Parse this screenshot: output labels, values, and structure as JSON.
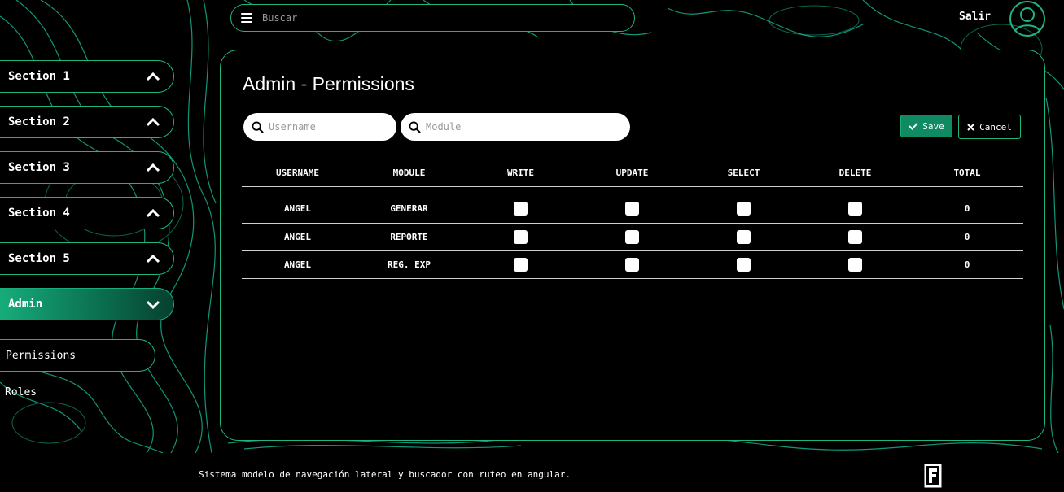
{
  "header": {
    "search_placeholder": "Buscar",
    "logout_label": "Salir"
  },
  "sidebar": {
    "sections": [
      {
        "label": "Section 1",
        "expanded": false
      },
      {
        "label": "Section 2",
        "expanded": false
      },
      {
        "label": "Section 3",
        "expanded": false
      },
      {
        "label": "Section 4",
        "expanded": false
      },
      {
        "label": "Section 5",
        "expanded": false
      },
      {
        "label": "Admin",
        "expanded": true
      }
    ],
    "sub_items": [
      {
        "label": "Permissions",
        "selected": true
      },
      {
        "label": "Roles",
        "selected": false
      }
    ]
  },
  "main": {
    "title_part1": "Admin",
    "title_sep": "-",
    "title_part2": "Permissions",
    "filters": {
      "username_placeholder": "Username",
      "module_placeholder": "Module"
    },
    "save_label": "Save",
    "cancel_label": "Cancel",
    "table": {
      "columns": [
        "USERNAME",
        "MODULE",
        "WRITE",
        "UPDATE",
        "SELECT",
        "DELETE",
        "TOTAL"
      ],
      "rows": [
        {
          "username": "ANGEL",
          "module": "GENERAR",
          "write": false,
          "update": false,
          "select": false,
          "delete": false,
          "total": "0"
        },
        {
          "username": "ANGEL",
          "module": "REPORTE",
          "write": false,
          "update": false,
          "select": false,
          "delete": false,
          "total": "0"
        },
        {
          "username": "ANGEL",
          "module": "REG. EXP",
          "write": false,
          "update": false,
          "select": false,
          "delete": false,
          "total": "0"
        }
      ]
    }
  },
  "footer": {
    "text": "Sistema modelo de navegación lateral y buscador con ruteo en angular."
  },
  "colors": {
    "accent": "#1fb583",
    "active_gradient_start": "#17ae7c",
    "background": "#000000",
    "save_button": "#0f8a63"
  },
  "icons": {
    "menu": "hamburger-icon",
    "avatar": "user-circle-icon",
    "collapse": "chevron-up-icon",
    "expand": "chevron-down-icon",
    "search": "magnifier-icon",
    "save": "check-icon",
    "cancel": "close-icon",
    "footer_logo": "f-logo-icon"
  }
}
